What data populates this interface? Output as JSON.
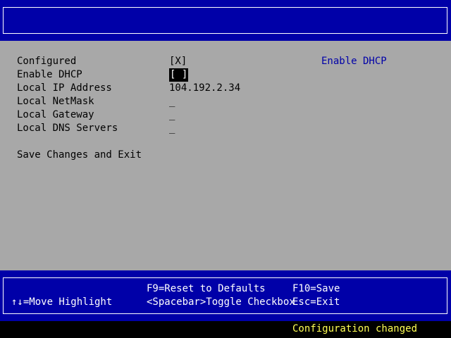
{
  "settings": {
    "rows": [
      {
        "label": "Configured",
        "value": "[X]"
      },
      {
        "label": "Enable DHCP",
        "value": "[ ]"
      },
      {
        "label": "Local IP Address",
        "value": "104.192.2.34"
      },
      {
        "label": "Local NetMask",
        "value": "_"
      },
      {
        "label": "Local Gateway",
        "value": "_"
      },
      {
        "label": "Local DNS Servers",
        "value": "_"
      }
    ],
    "save_label": "Save Changes and Exit",
    "help_text": "Enable DHCP"
  },
  "keys": {
    "move": "↑↓=Move Highlight",
    "reset": "F9=Reset to Defaults",
    "toggle": "<Spacebar>Toggle Checkbox",
    "save": "F10=Save",
    "exit": "Esc=Exit"
  },
  "status": {
    "message": "Configuration changed"
  },
  "colors": {
    "band": "#0000a8",
    "panel": "#a8a8a8",
    "help": "#0000a8",
    "status": "#ffff55"
  }
}
